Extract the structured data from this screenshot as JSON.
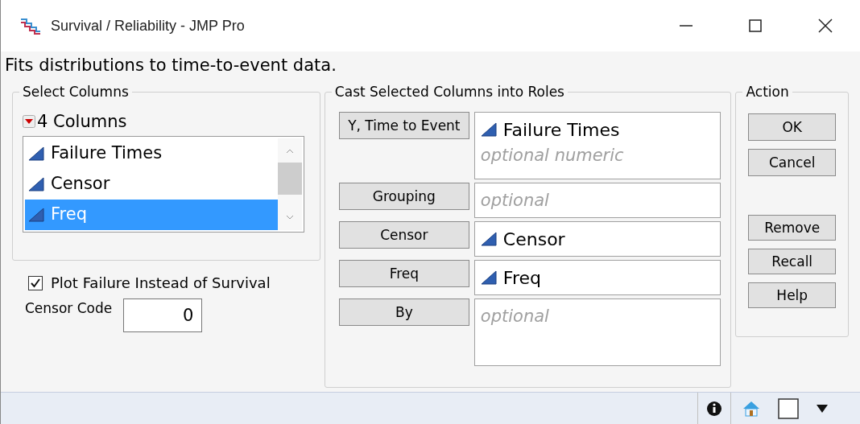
{
  "window": {
    "title": "Survival / Reliability - JMP Pro"
  },
  "description": "Fits distributions to time-to-event data.",
  "select_columns": {
    "title": "Select Columns",
    "count_label": "4 Columns",
    "columns": [
      {
        "name": "Failure Times",
        "selected": false
      },
      {
        "name": "Censor",
        "selected": false
      },
      {
        "name": "Freq",
        "selected": true
      }
    ]
  },
  "plot_failure": {
    "label": "Plot Failure Instead of Survival",
    "checked": true
  },
  "censor_code": {
    "label": "Censor Code",
    "value": "0"
  },
  "roles": {
    "title": "Cast Selected Columns into Roles",
    "rows": [
      {
        "button": "Y, Time to Event",
        "kind": "tall",
        "items": [
          {
            "kind": "column",
            "text": "Failure Times"
          },
          {
            "kind": "placeholder",
            "text": "optional numeric"
          }
        ]
      },
      {
        "button": "Grouping",
        "kind": "short",
        "items": [
          {
            "kind": "placeholder",
            "text": "optional"
          }
        ]
      },
      {
        "button": "Censor",
        "kind": "short",
        "items": [
          {
            "kind": "column",
            "text": "Censor"
          }
        ]
      },
      {
        "button": "Freq",
        "kind": "short",
        "items": [
          {
            "kind": "column",
            "text": "Freq"
          }
        ]
      },
      {
        "button": "By",
        "kind": "tall",
        "items": [
          {
            "kind": "placeholder",
            "text": "optional"
          }
        ]
      }
    ]
  },
  "action": {
    "title": "Action",
    "primary_buttons": [
      "OK",
      "Cancel"
    ],
    "secondary_buttons": [
      "Remove",
      "Recall",
      "Help"
    ]
  }
}
